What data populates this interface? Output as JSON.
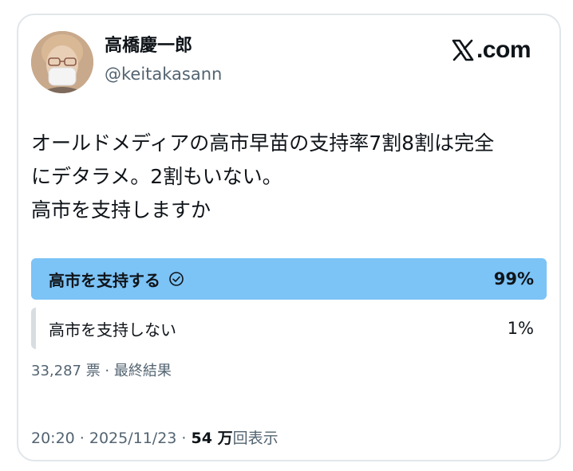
{
  "author": {
    "name": "高橋慶一郎",
    "handle": "@keitakasann"
  },
  "brand": {
    "label": ".com",
    "icon": "x-logo-icon"
  },
  "tweet": {
    "lines": [
      "オールドメディアの高市早苗の支持率7割8割は完全",
      "にデタラメ。2割もいない。",
      "高市を支持しますか"
    ]
  },
  "poll": {
    "options": [
      {
        "label": "高市を支持する",
        "percent_text": "99%",
        "percent": 99,
        "selected": true
      },
      {
        "label": "高市を支持しない",
        "percent_text": "1%",
        "percent": 1,
        "selected": false
      }
    ],
    "meta": "33,287 票 · 最終結果"
  },
  "footer": {
    "time": "20:20 · 2025/11/23 · ",
    "views_count": "54 万",
    "views_label": "回表示"
  },
  "colors": {
    "poll_winner": "#7cc3f6",
    "poll_loser": "#d8dde1",
    "secondary_text": "#536471",
    "border": "#e1e6ea"
  }
}
